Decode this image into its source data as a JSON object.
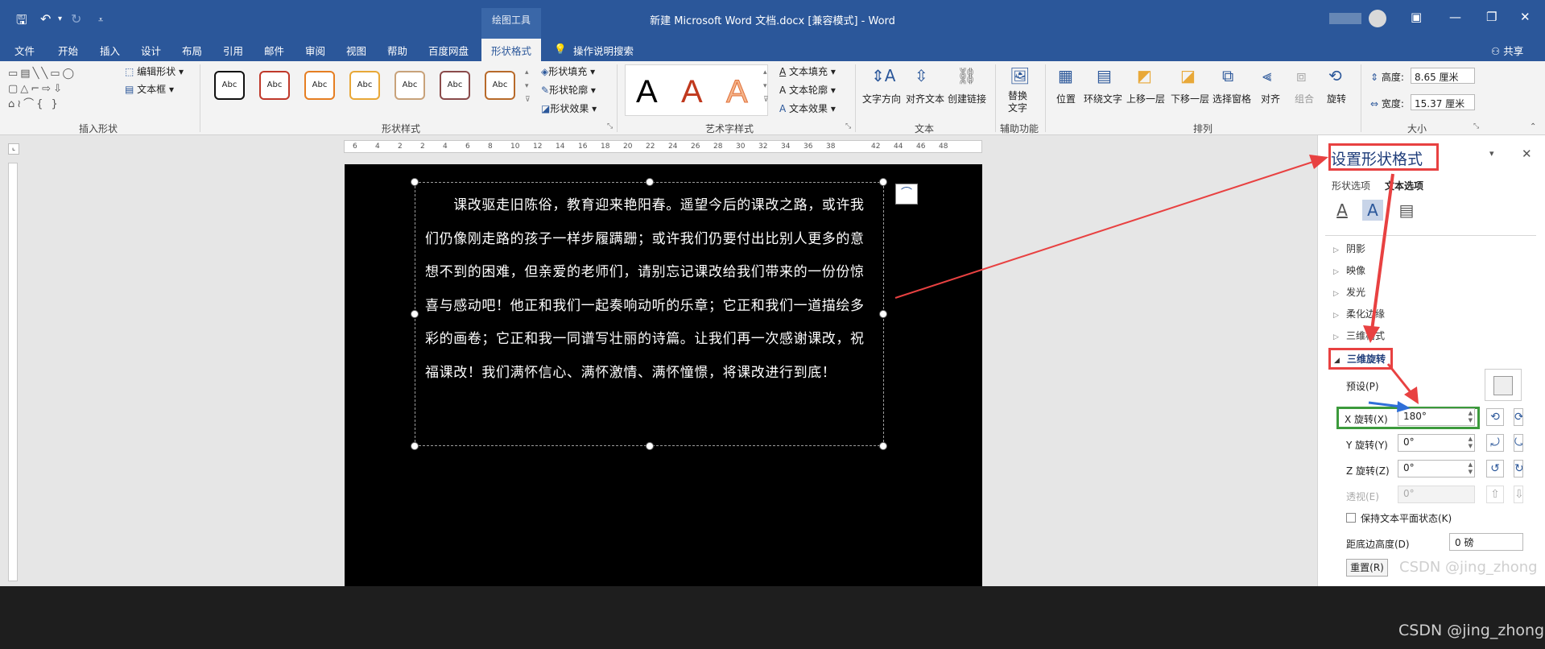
{
  "titlebar": {
    "context_tools": "绘图工具",
    "document_title": "新建 Microsoft Word 文档.docx [兼容模式]  -  Word",
    "share": "共享"
  },
  "tabs": [
    "文件",
    "开始",
    "插入",
    "设计",
    "布局",
    "引用",
    "邮件",
    "审阅",
    "视图",
    "帮助",
    "百度网盘"
  ],
  "active_tab": "形状格式",
  "tell_me": "操作说明搜索",
  "ribbon": {
    "insert_shapes": {
      "edit_shape": "编辑形状",
      "text_box": "文本框",
      "label": "插入形状"
    },
    "shape_styles": {
      "swatch_text": "Abc",
      "fill": "形状填充",
      "outline": "形状轮廓",
      "effects": "形状效果",
      "label": "形状样式"
    },
    "wordart": {
      "letter": "A",
      "text_fill": "文本填充",
      "text_outline": "文本轮廓",
      "text_effects": "文本效果",
      "label": "艺术字样式"
    },
    "text": {
      "direction": "文字方向",
      "align": "对齐文本",
      "link": "创建链接",
      "label": "文本"
    },
    "accessibility": {
      "alt_text_1": "替换",
      "alt_text_2": "文字",
      "label": "辅助功能"
    },
    "arrange": {
      "position": "位置",
      "wrap": "环绕文字",
      "forward": "上移一层",
      "backward": "下移一层",
      "pane": "选择窗格",
      "align": "对齐",
      "group": "组合",
      "rotate": "旋转",
      "label": "排列"
    },
    "size": {
      "height_label": "高度:",
      "height_value": "8.65 厘米",
      "width_label": "宽度:",
      "width_value": "15.37 厘米",
      "label": "大小"
    }
  },
  "ruler_marks": [
    "6",
    "4",
    "2",
    "2",
    "4",
    "6",
    "8",
    "10",
    "12",
    "14",
    "16",
    "18",
    "20",
    "22",
    "24",
    "26",
    "28",
    "30",
    "32",
    "34",
    "36",
    "38",
    "42",
    "44",
    "46",
    "48"
  ],
  "document": {
    "paragraph": "　　课改驱走旧陈俗，教育迎来艳阳春。遥望今后的课改之路，或许我们仍像刚走路的孩子一样步履蹒跚；或许我们仍要付出比别人更多的意想不到的困难，但亲爱的老师们，请别忘记课改给我们带来的一份份惊喜与感动吧！他正和我们一起奏响动听的乐章；它正和我们一道描绘多彩的画卷；它正和我一同谱写壮丽的诗篇。让我们再一次感谢课改，祝福课改！我们满怀信心、满怀激情、满怀憧憬，将课改进行到底！"
  },
  "pane": {
    "title": "设置形状格式",
    "tab_shape": "形状选项",
    "tab_text": "文本选项",
    "sections": [
      "阴影",
      "映像",
      "发光",
      "柔化边缘",
      "三维格式",
      "三维旋转"
    ],
    "preset_label": "预设(P)",
    "x_label": "X 旋转(X)",
    "x_value": "180°",
    "y_label": "Y 旋转(Y)",
    "y_value": "0°",
    "z_label": "Z 旋转(Z)",
    "z_value": "0°",
    "persp_label": "透视(E)",
    "persp_value": "0°",
    "keep_flat": "保持文本平面状态(K)",
    "distance_label": "距底边高度(D)",
    "distance_value": "0 磅",
    "reset": "重置(R)"
  },
  "watermarks": [
    "CSDN @jing_zhong",
    "CSDN @jing_zhong"
  ],
  "colors": {
    "brand": "#2b579a",
    "annotation": "#e84141",
    "highlight_box": "#3c9a3c",
    "arrow_blue": "#2f6fd8"
  }
}
